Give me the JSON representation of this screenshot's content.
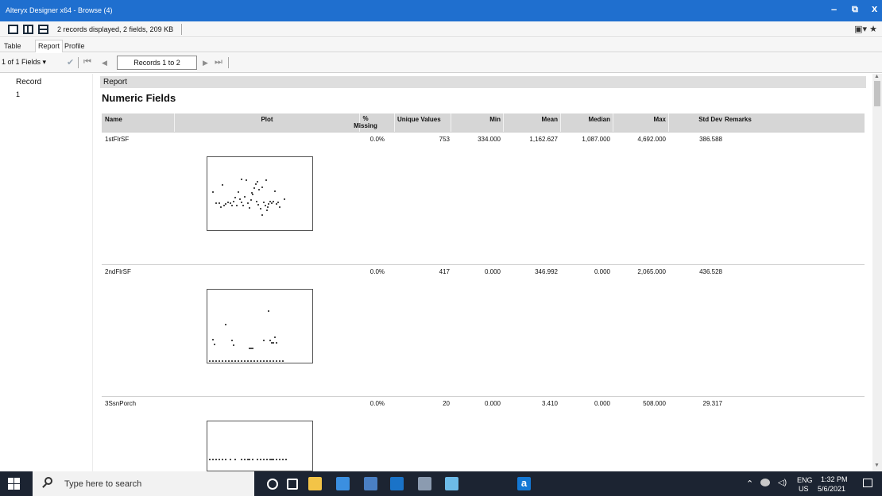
{
  "window": {
    "title": "Alteryx Designer x64 - Browse (4)",
    "minimize": "–",
    "restore": "⧉",
    "close": "x"
  },
  "toolbar": {
    "info": "2 records displayed, 2 fields, 209 KB",
    "right_icons": "▣▾ ★"
  },
  "tabs": [
    "Table",
    "Report",
    "Profile"
  ],
  "nav": {
    "field_select": "1 of 1 Fields ▾",
    "check": "✔",
    "first": "⏮",
    "prev": "◀",
    "records": "Records 1 to 2",
    "next": "▶",
    "last": "⏭"
  },
  "report": {
    "record_header": "Record",
    "report_header": "Report",
    "record_number": "1",
    "section_title": "Numeric Fields",
    "columns": {
      "name": "Name",
      "plot": "Plot",
      "missing_pct": "%",
      "missing_word": "Missing",
      "unique": "Unique Values",
      "min": "Min",
      "mean": "Mean",
      "median": "Median",
      "max": "Max",
      "std": "Std Dev",
      "remarks": "Remarks"
    },
    "rows": [
      {
        "name": "1stFlrSF",
        "missing": "0.0%",
        "unique": "753",
        "min": "334.000",
        "mean": "1,162.627",
        "median": "1,087.000",
        "max": "4,692.000",
        "std": "386.588",
        "remarks": ""
      },
      {
        "name": "2ndFlrSF",
        "missing": "0.0%",
        "unique": "417",
        "min": "0.000",
        "mean": "346.992",
        "median": "0.000",
        "max": "2,065.000",
        "std": "436.528",
        "remarks": ""
      },
      {
        "name": "3SsnPorch",
        "missing": "0.0%",
        "unique": "20",
        "min": "0.000",
        "mean": "3.410",
        "median": "0.000",
        "max": "508.000",
        "std": "29.317",
        "remarks": ""
      }
    ]
  },
  "taskbar": {
    "search_placeholder": "Type here to search",
    "lang_top": "ENG",
    "lang_bottom": "US",
    "time": "1:32 PM",
    "date": "5/6/2021",
    "tray_icons": "⌃"
  }
}
